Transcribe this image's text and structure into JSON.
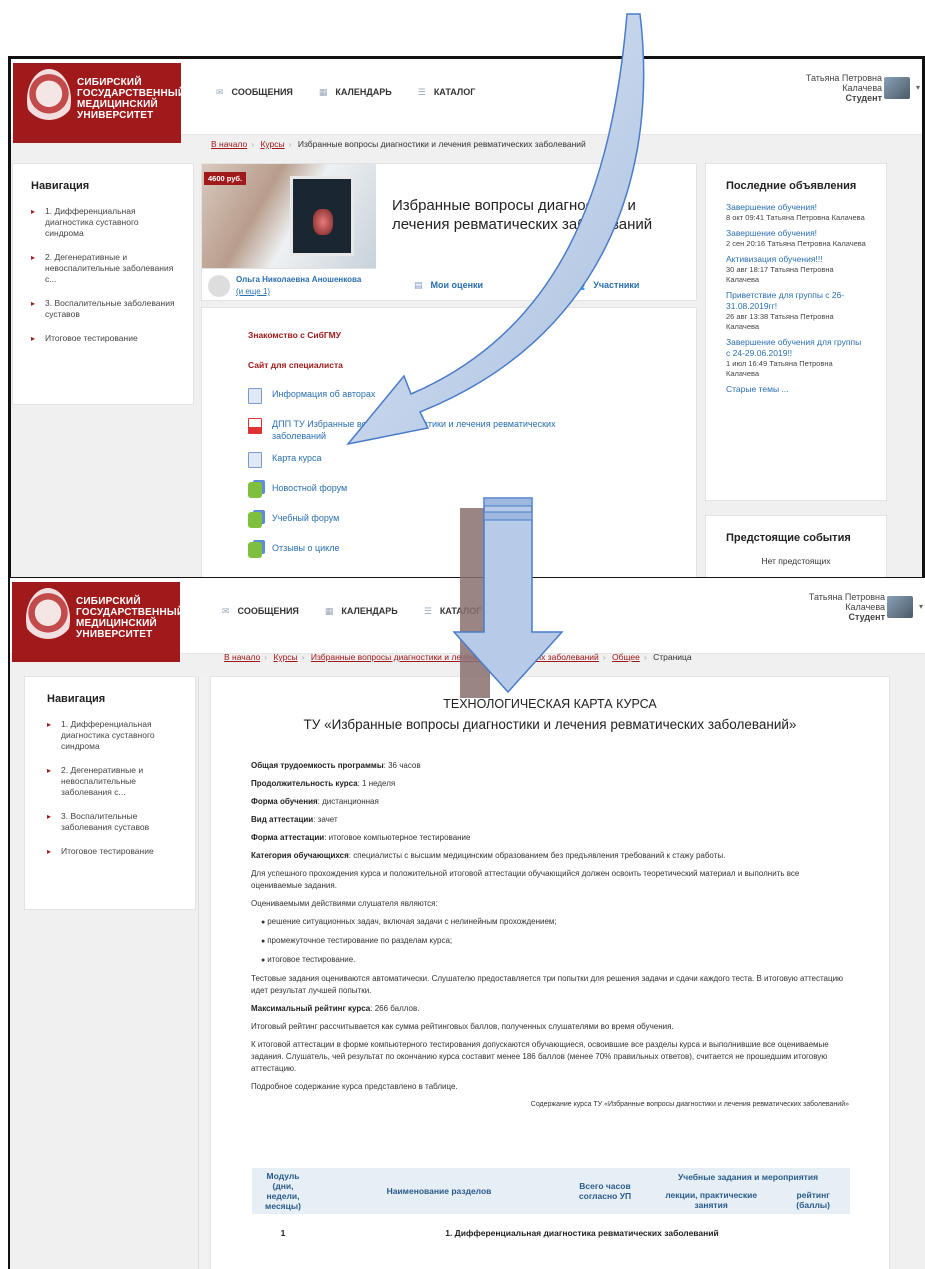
{
  "brand": {
    "logo_text": "СИБИРСКИЙ ГОСУДАРСТВЕННЫЙ МЕДИЦИНСКИЙ УНИВЕРСИТЕТ",
    "color": "#a0191b"
  },
  "topnav": {
    "messages": "СООБЩЕНИЯ",
    "calendar": "КАЛЕНДАРЬ",
    "catalog": "КАТАЛОГ",
    "catalog_short": "КАТАЛОГ"
  },
  "user": {
    "first": "Татьяна Петровна",
    "last": "Калачева",
    "role": "Студент"
  },
  "shot1": {
    "breadcrumb": {
      "home": "В начало",
      "courses": "Курсы",
      "current": "Избранные вопросы диагностики и лечения ревматических заболеваний"
    },
    "nav_title": "Навигация",
    "nav_items": [
      "1. Дифференциальная диагностика суставного синдрома",
      "2. Дегенеративные и невоспалительные заболевания с...",
      "3. Воспалительные заболевания суставов",
      "Итоговое тестирование"
    ],
    "course": {
      "price": "4600 руб.",
      "title": "Избранные вопросы диагностики и лечения ревматических заболеваний",
      "teacher": "Ольга Николаевна Аношенкова",
      "teacher_more": "(и еще 1)",
      "grades": "Мои оценки",
      "participants": "Участники"
    },
    "links": {
      "intro": "Знакомство с СибГМУ",
      "site": "Сайт для специалиста",
      "resources": [
        {
          "label": "Информация об авторах",
          "type": "doc"
        },
        {
          "label": "ДПП ТУ Избранные вопросы диагностики и лечения ревматических заболеваний",
          "type": "pdf"
        },
        {
          "label": "Карта курса",
          "type": "doc"
        },
        {
          "label": "Новостной форум",
          "type": "forum"
        },
        {
          "label": "Учебный форум",
          "type": "forum"
        },
        {
          "label": "Отзывы о цикле",
          "type": "forum"
        }
      ]
    },
    "announcements": {
      "title": "Последние объявления",
      "items": [
        {
          "title": "Завершение обучения!",
          "meta": "8 окт 09:41 Татьяна Петровна Калачева"
        },
        {
          "title": "Завершение обучения!",
          "meta": "2 сен 20:16 Татьяна Петровна Калачева"
        },
        {
          "title": "Активизация обучения!!!",
          "meta": "30 авг 18:17 Татьяна Петровна Калачева"
        },
        {
          "title": "Приветствие для группы с 26-31.08.2019гг!",
          "meta": "26 авг 13:38 Татьяна Петровна Калачева"
        },
        {
          "title": "Завершение обучения для группы с 24-29.06.2019!!",
          "meta": "1 июл 16:49 Татьяна Петровна Калачева"
        }
      ],
      "older": "Старые темы ..."
    },
    "events": {
      "title": "Предстоящие события",
      "none": "Нет предстоящих"
    }
  },
  "shot2": {
    "breadcrumb": {
      "home": "В начало",
      "courses": "Курсы",
      "course": "Избранные вопросы диагностики и лечения ревматических заболеваний",
      "general": "Общее",
      "current": "Страница"
    },
    "page_title_1": "ТЕХНОЛОГИЧЕСКАЯ КАРТА КУРСА",
    "page_title_2": "ТУ «Избранные вопросы диагностики и лечения ревматических заболеваний»",
    "facts": [
      {
        "label": "Общая трудоемкость программы",
        "value": ": 36 часов"
      },
      {
        "label": "Продолжительность курса",
        "value": ": 1 неделя"
      },
      {
        "label": "Форма обучения",
        "value": ": дистанционная"
      },
      {
        "label": "Вид аттестации",
        "value": ": зачет"
      },
      {
        "label": "Форма аттестации",
        "value": ": итоговое компьютерное тестирование"
      },
      {
        "label": "Категория обучающихся",
        "value": ": специалисты с высшим медицинским образованием без предъявления требований к стажу работы."
      }
    ],
    "p1": "Для успешного прохождения курса и положительной итоговой аттестации обучающийся должен освоить теоретический материал и выполнить все оцениваемые задания.",
    "p2": "Оцениваемыми действиями слушателя являются:",
    "bullets": [
      "решение ситуационных задач, включая задачи с нелинейным прохождением;",
      "промежуточное тестирование по разделам курса;",
      "итоговое тестирование."
    ],
    "p3": "Тестовые задания оцениваются автоматически. Слушателю предоставляется три попытки для решения задачи и сдачи каждого теста. В итоговую аттестацию идет результат лучшей попытки.",
    "max_label": "Максимальный рейтинг курса",
    "max_value": ": 266 баллов.",
    "p4": "Итоговый рейтинг рассчитывается как сумма рейтинговых баллов, полученных слушателями во время обучения.",
    "p5": "К итоговой аттестации в форме компьютерного тестирования допускаются обучающиеся, освоившие все разделы курса и выполнившие все оцениваемые задания. Слушатель, чей результат по окончанию курса составит менее 186 баллов (менее 70% правильных ответов), считается не прошедшим итоговую аттестацию.",
    "p6": "Подробное содержание курса представлено в таблице.",
    "table_caption": "Содержание курса ТУ «Избранные вопросы диагностики и лечения ревматических заболеваний»",
    "table": {
      "h_module": "Модуль (дни, недели, месяцы)",
      "h_sections": "Наименование разделов",
      "h_hours": "Всего часов согласно УП",
      "h_tasks": "Учебные задания и мероприятия",
      "h_lectures": "лекции, практические занятия",
      "h_rating": "рейтинг (баллы)",
      "row1_num": "1",
      "row1_title": "1. Дифференциальная диагностика ревматических заболеваний"
    }
  }
}
